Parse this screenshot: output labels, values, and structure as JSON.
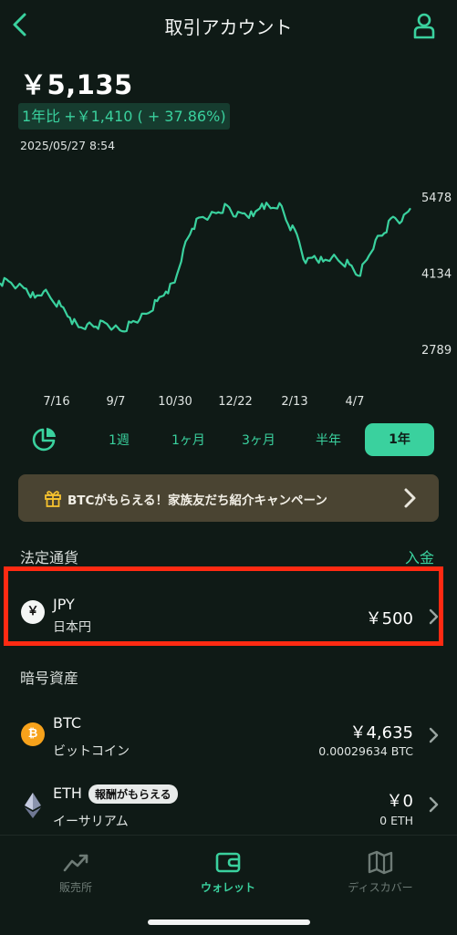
{
  "header": {
    "title": "取引アカウント"
  },
  "summary": {
    "balance": "￥5,135",
    "change_label": "1年比",
    "change_value": "+￥1,410 ( + 37.86%)",
    "timestamp": "2025/05/27 8:54"
  },
  "chart_data": {
    "type": "line",
    "y_ticks": [
      "5478",
      "4134",
      "2789"
    ],
    "x_ticks": [
      "7/16",
      "9/7",
      "10/30",
      "12/22",
      "2/13",
      "4/7"
    ],
    "ylim": [
      2789,
      5478
    ],
    "values": [
      3960,
      3990,
      3900,
      3860,
      3700,
      3810,
      3650,
      3550,
      3350,
      3180,
      3230,
      3190,
      3260,
      3170,
      3110,
      3260,
      3320,
      3430,
      3640,
      3810,
      3970,
      4560,
      4920,
      5120,
      5140,
      5210,
      5330,
      5130,
      5190,
      5140,
      5360,
      5280,
      5370,
      4990,
      4820,
      4310,
      4440,
      4340,
      4410,
      4320,
      4290,
      4090,
      4370,
      4720,
      4840,
      5130,
      5050,
      5280
    ],
    "color": "#3ad19e"
  },
  "ranges": {
    "items": [
      "1週",
      "1ヶ月",
      "3ヶ月",
      "半年",
      "1年"
    ],
    "active": "1年"
  },
  "banner": {
    "text": "BTCがもらえる！家族友だち紹介キャンペーン"
  },
  "fiat": {
    "section_title": "法定通貨",
    "deposit_label": "入金",
    "symbol": "￥",
    "code": "JPY",
    "name": "日本円",
    "amount": "￥500"
  },
  "crypto": {
    "section_title": "暗号資産",
    "items": [
      {
        "code": "BTC",
        "name": "ビットコイン",
        "amount": "￥4,635",
        "qty": "0.00029634 BTC",
        "symbol": "₿"
      },
      {
        "code": "ETH",
        "name": "イーサリアム",
        "amount": "￥0",
        "qty": "0 ETH",
        "badge": "報酬がもらえる"
      }
    ]
  },
  "nav": {
    "items": [
      {
        "label": "販売所",
        "icon": "chart-trend-icon"
      },
      {
        "label": "ウォレット",
        "icon": "wallet-icon"
      },
      {
        "label": "ディスカバー",
        "icon": "map-icon"
      }
    ]
  },
  "colors": {
    "accent": "#3ad19e",
    "background": "#0f1a16",
    "highlight": "#ff2a12"
  }
}
